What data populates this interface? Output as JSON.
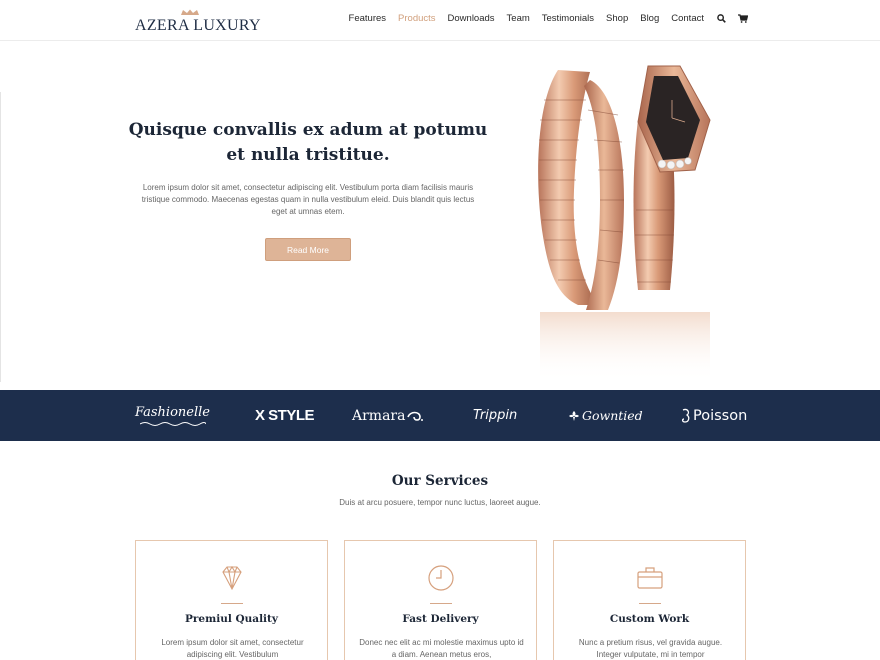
{
  "header": {
    "logo_text": "AZERA LUXURY",
    "nav": [
      "Features",
      "Products",
      "Downloads",
      "Team",
      "Testimonials",
      "Shop",
      "Blog",
      "Contact"
    ],
    "active_nav": "Products",
    "icons": [
      "search-icon",
      "cart-icon"
    ]
  },
  "hero": {
    "title": "Quisque convallis ex adum at potumu et nulla tristitue.",
    "text": "Lorem ipsum dolor sit amet, consectetur adipiscing elit. Vestibulum porta diam facilisis mauris tristique commodo. Maecenas egestas quam in nulla vestibulum eleid. Duis blandit quis lectus eget at umnas etem.",
    "button": "Read More"
  },
  "brands": [
    "Fashionelle",
    "X STYLE",
    "Armara",
    "Trippin",
    "Gowntied",
    "Poisson"
  ],
  "services": {
    "title": "Our Services",
    "subtitle": "Duis at arcu posuere, tempor nunc luctus, laoreet augue.",
    "cards": [
      {
        "icon": "diamond-icon",
        "title": "Premiul Quality",
        "text": "Lorem ipsum dolor sit amet, consectetur adipiscing elit. Vestibulum"
      },
      {
        "icon": "clock-icon",
        "title": "Fast Delivery",
        "text": "Donec nec elit ac mi molestie maximus upto id a diam. Aenean metus eros,"
      },
      {
        "icon": "briefcase-icon",
        "title": "Custom Work",
        "text": "Nunc a pretium risus, vel gravida augue. Integer vulputate, mi in tempor"
      }
    ]
  },
  "colors": {
    "accent": "#d1a07d",
    "navy": "#1d2e4c",
    "heading": "#1c2636"
  }
}
